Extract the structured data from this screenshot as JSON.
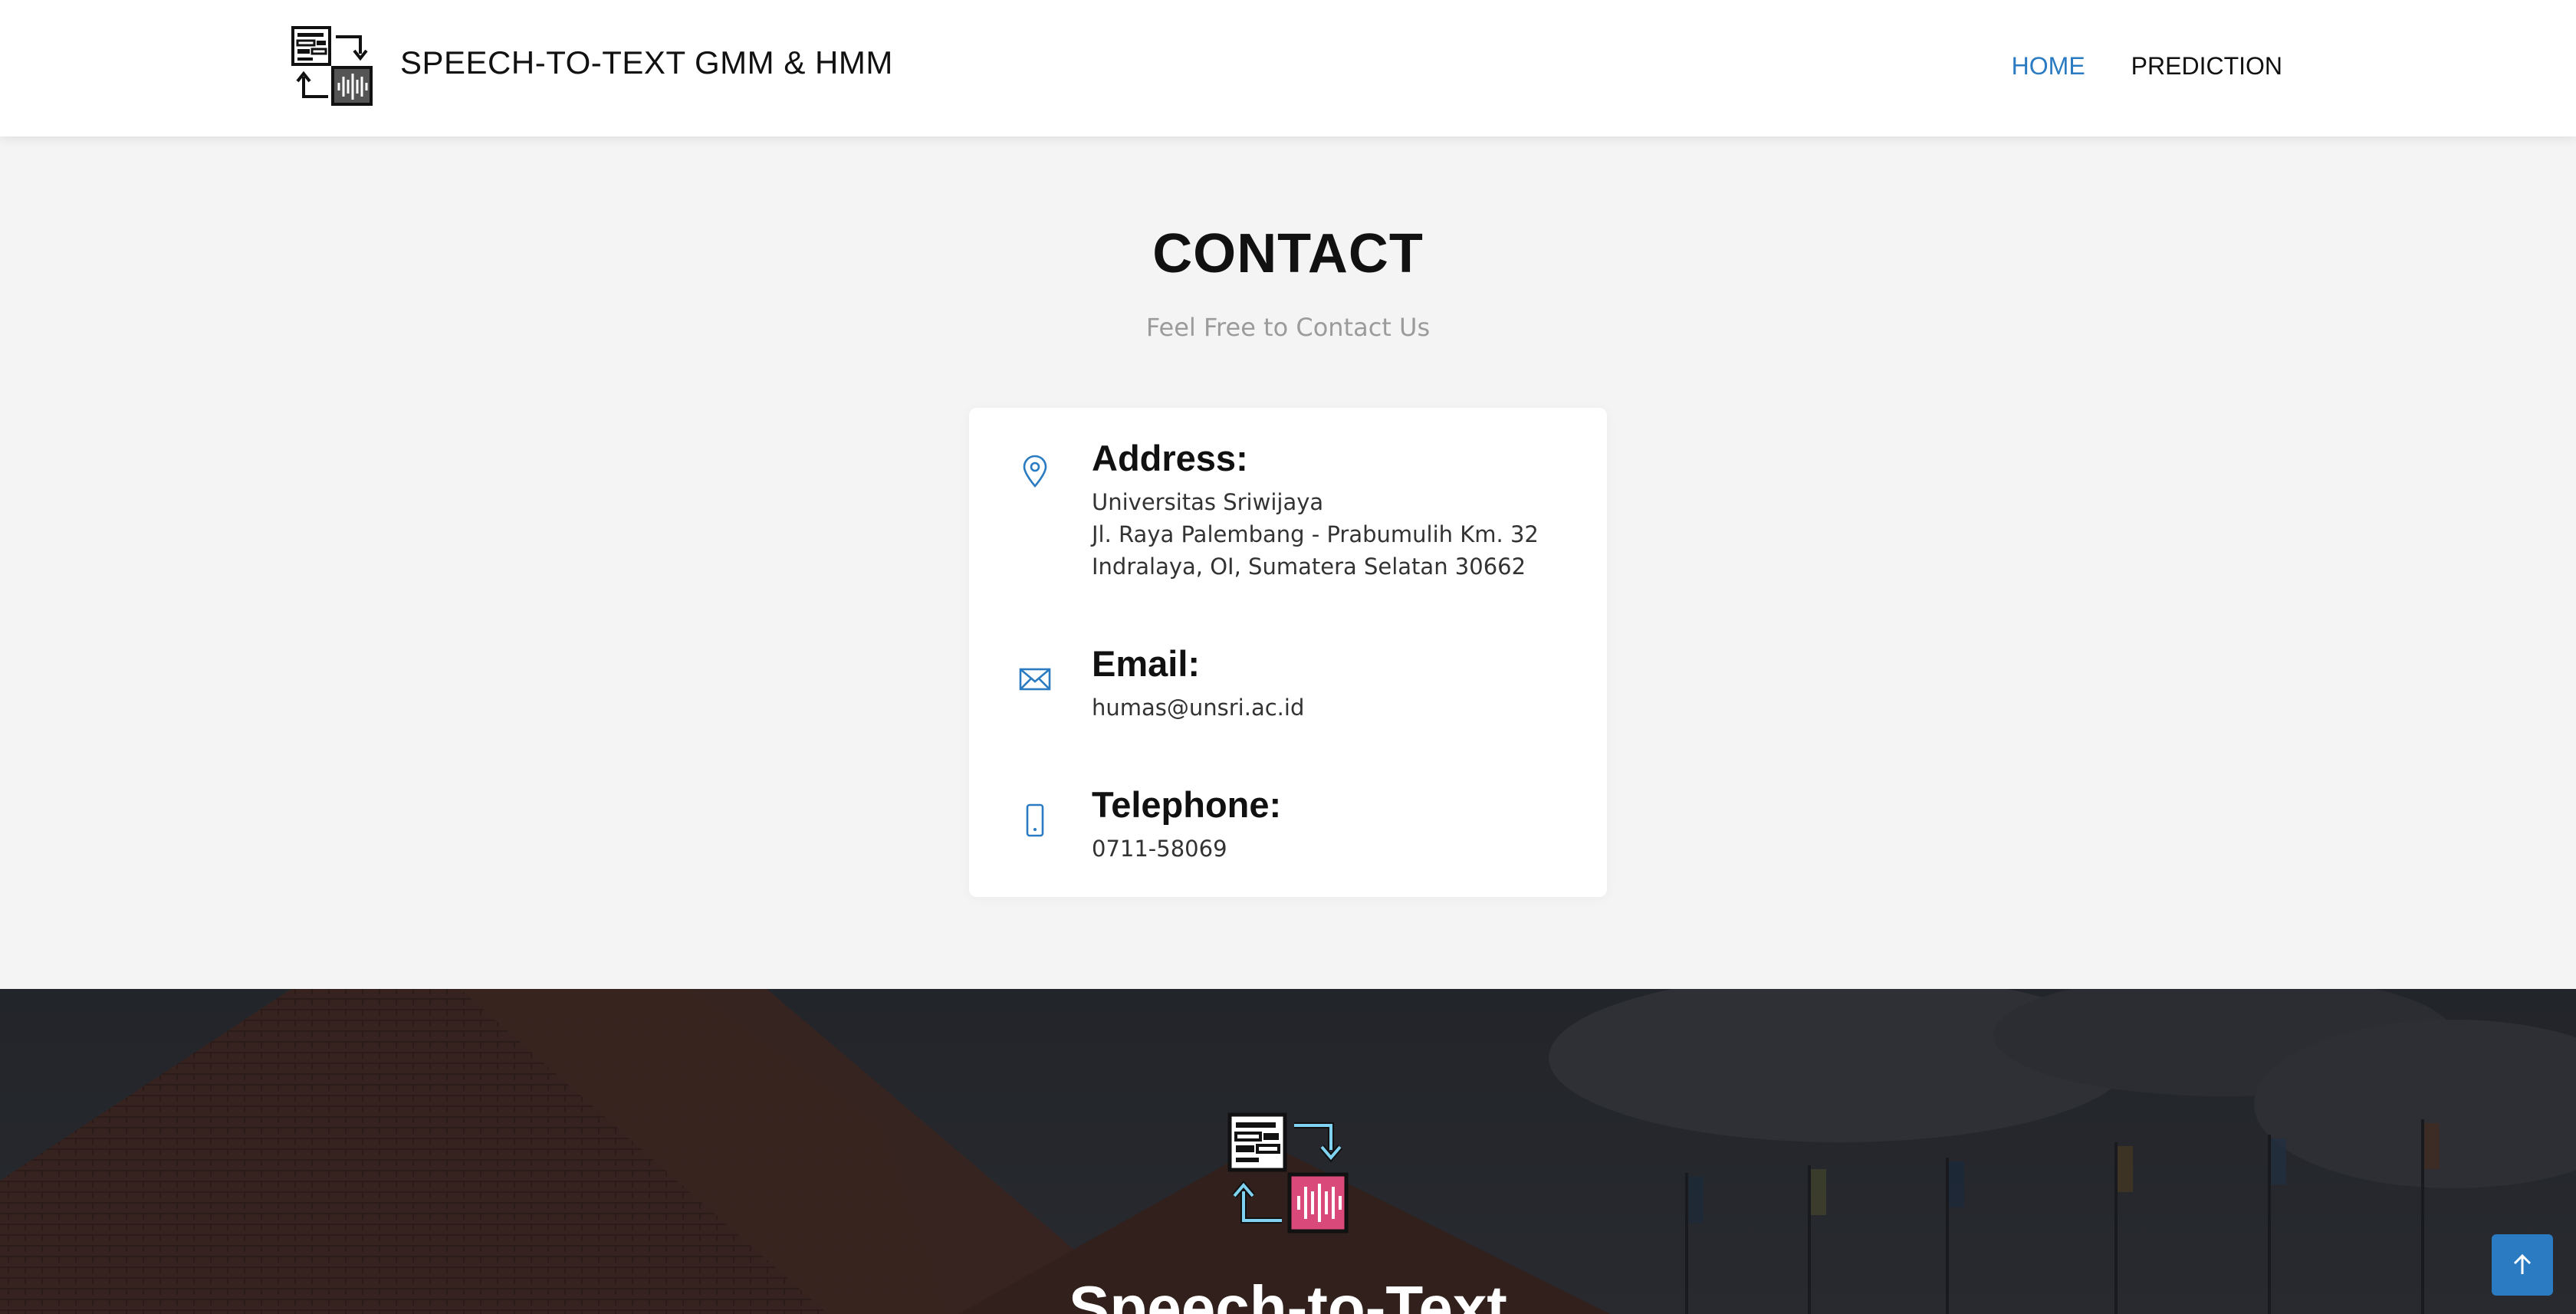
{
  "header": {
    "brand": "SPEECH-TO-TEXT GMM & HMM",
    "nav": [
      {
        "label": "HOME",
        "active": true
      },
      {
        "label": "PREDICTION",
        "active": false
      }
    ]
  },
  "contact": {
    "title": "CONTACT",
    "subtitle": "Feel Free to Contact Us",
    "address": {
      "icon": "map-pin-icon",
      "heading": "Address:",
      "lines": [
        "Universitas Sriwijaya",
        "Jl. Raya Palembang - Prabumulih Km. 32",
        "Indralaya, OI, Sumatera Selatan 30662"
      ]
    },
    "email": {
      "icon": "envelope-icon",
      "heading": "Email:",
      "value": "humas@unsri.ac.id"
    },
    "telephone": {
      "icon": "phone-icon",
      "heading": "Telephone:",
      "value": "0711-58069"
    }
  },
  "footer": {
    "title": "Speech-to-Text"
  },
  "colors": {
    "accent": "#2a7bc1",
    "footer_logo_pink": "#d94a7a",
    "footer_logo_cyan": "#7fd3f0"
  },
  "icons": {
    "back_to_top": "arrow-up-icon",
    "logo": "speech-to-text-logo"
  }
}
